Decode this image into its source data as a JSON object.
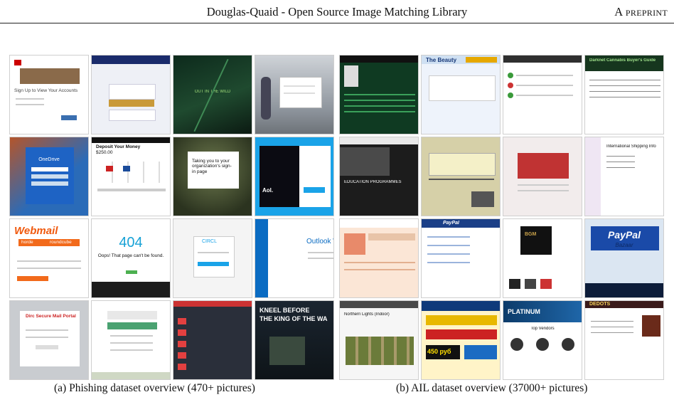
{
  "header": {
    "running_title": "Douglas-Quaid - Open Source Image Matching Library",
    "preprint": "A preprint"
  },
  "figure_a": {
    "caption": "(a) Phishing dataset overview (470+ pictures)",
    "tiles": [
      {
        "text": "Sign Up to View Your Accounts"
      },
      {
        "text": ""
      },
      {
        "text": "OUT IN THE WILD"
      },
      {
        "text": ""
      },
      {
        "text": "OneDrive"
      },
      {
        "text": "Deposit Your Money",
        "text2": "$250.00"
      },
      {
        "text": "Taking you to your organization's sign-in page"
      },
      {
        "text": "Aol."
      },
      {
        "text": "Webmail",
        "text2": "horde",
        "text3": "roundcube"
      },
      {
        "text": "404",
        "text2": "Oops! That page can't be found."
      },
      {
        "text": "CIRCL"
      },
      {
        "text": "Outlook W"
      },
      {
        "text": "Dirc Secure Mail Portal"
      },
      {
        "text": ""
      },
      {
        "text": ""
      },
      {
        "text": "KNEEL BEFORE",
        "text2": "THE KING OF THE WA"
      }
    ]
  },
  "figure_b": {
    "caption": "(b) AIL dataset overview (37000+ pictures)",
    "tiles": [
      {
        "text": ""
      },
      {
        "text": "The Beauty"
      },
      {
        "text": ""
      },
      {
        "text": "Darknet Cannabis Buyer's Guide"
      },
      {
        "text": "EDUCATION PROGRAMMES"
      },
      {
        "text": ""
      },
      {
        "text": ""
      },
      {
        "text": "International Shipping Info"
      },
      {
        "text": ""
      },
      {
        "text": "PayPal"
      },
      {
        "text": "BGM"
      },
      {
        "text": "PayPal",
        "text2": "Bazaar"
      },
      {
        "text": "Northern Lights (Indoor)"
      },
      {
        "text": "450 руб"
      },
      {
        "text": "PLATINUM",
        "text2": "Top Vendors"
      },
      {
        "text": "DEDOTS"
      }
    ]
  }
}
